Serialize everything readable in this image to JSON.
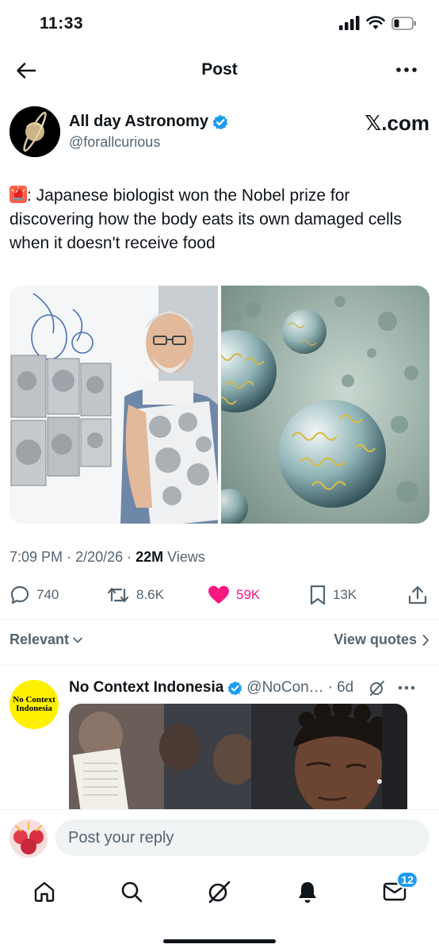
{
  "status_bar": {
    "time": "11:33"
  },
  "nav": {
    "title": "Post"
  },
  "author": {
    "name": "All day Astronomy",
    "handle": "@forallcurious",
    "brand": "𝕏.com"
  },
  "tweet": {
    "text": ": Japanese biologist won the Nobel prize for discovering how the body eats its own damaged cells when it doesn't receive  food",
    "time": "7:09 PM",
    "date": "2/20/26",
    "views_count": "22M",
    "views_label": "Views"
  },
  "actions": {
    "replies": "740",
    "reposts": "8.6K",
    "likes": "59K",
    "bookmarks": "13K"
  },
  "filter": {
    "sort_label": "Relevant",
    "quotes_label": "View quotes"
  },
  "reply": {
    "avatar_line1": "No Context",
    "avatar_line2": "Indonesia",
    "name": "No Context Indonesia",
    "handle": "@NoCon…",
    "age": "6d"
  },
  "composer": {
    "placeholder": "Post your reply"
  },
  "tabs": {
    "messages_badge": "12"
  },
  "colors": {
    "accent": "#1d9bf0",
    "like": "#f91880",
    "muted": "#536471",
    "text": "#0f1419"
  }
}
